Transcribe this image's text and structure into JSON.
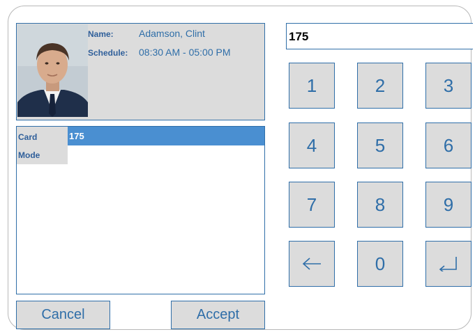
{
  "employee": {
    "name_label": "Name:",
    "name_value": "Adamson, Clint",
    "schedule_label": "Schedule:",
    "schedule_value": "08:30 AM - 05:00 PM",
    "photo_icon": "employee-photo"
  },
  "entry_list": {
    "card_label": "Card",
    "card_value": "175",
    "mode_label": "Mode",
    "mode_value": ""
  },
  "actions": {
    "cancel_label": "Cancel",
    "accept_label": "Accept"
  },
  "keypad": {
    "display_value": "175",
    "keys": [
      "1",
      "2",
      "3",
      "4",
      "5",
      "6",
      "7",
      "8",
      "9"
    ],
    "zero": "0",
    "backspace_icon": "arrow-left-icon",
    "enter_icon": "enter-return-icon"
  },
  "colors": {
    "accent": "#2f6ea8",
    "selection": "#4a8fd1",
    "panel_bg": "#dcdcdc"
  }
}
